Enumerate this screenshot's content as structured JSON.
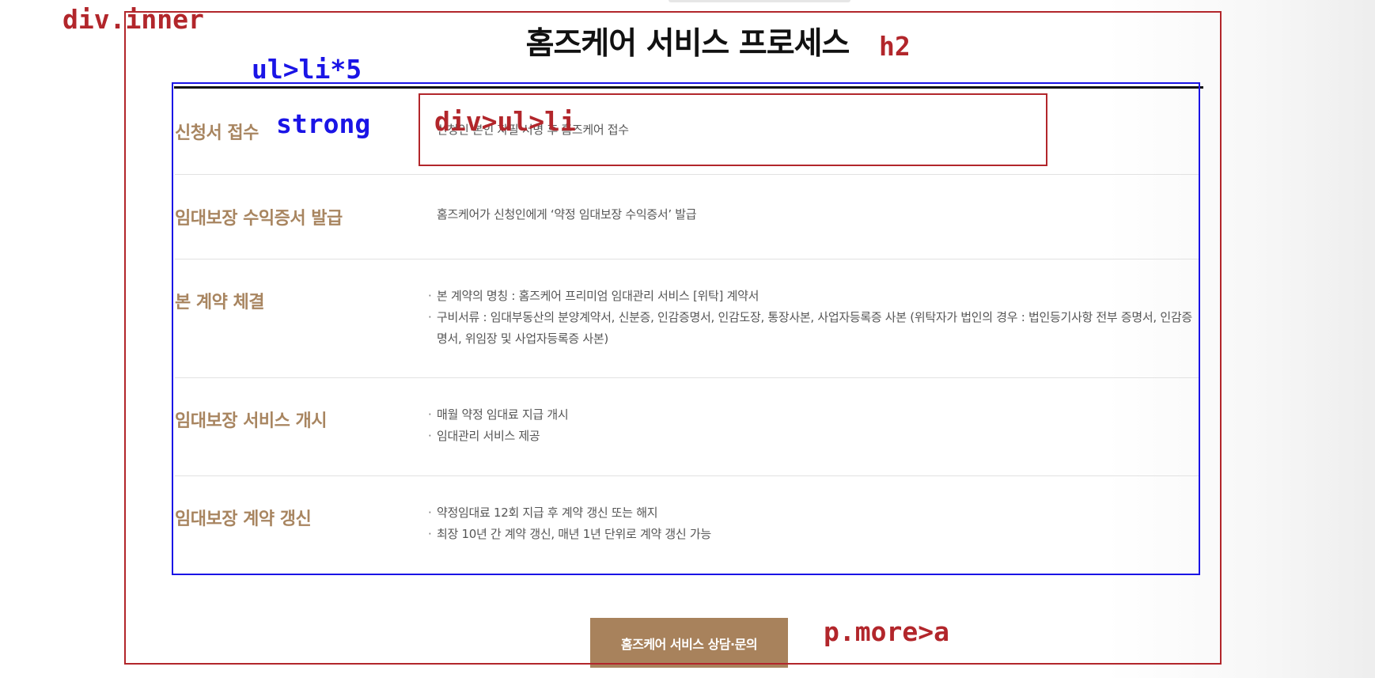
{
  "section": {
    "title": "홈즈케어 서비스 프로세스",
    "more_link": "홈즈케어 서비스 상담·문의"
  },
  "steps": [
    {
      "title": "신청서 접수",
      "items": [
        "신청인 본인 자필 서명 후 홈즈케어 접수"
      ],
      "bulleted": false
    },
    {
      "title": "임대보장 수익증서 발급",
      "items": [
        "홈즈케어가 신청인에게 ‘약정 임대보장 수익증서’ 발급"
      ],
      "bulleted": false
    },
    {
      "title": "본 계약 체결",
      "items": [
        "본 계약의 명칭 : 홈즈케어 프리미엄 임대관리 서비스 [위탁] 계약서",
        "구비서류 : 임대부동산의 분양계약서, 신분증, 인감증명서, 인감도장, 통장사본, 사업자등록증 사본 (위탁자가 법인의 경우 : 법인등기사항 전부 증명서, 인감증명서, 위임장 및 사업자등록증 사본)"
      ],
      "bulleted": true
    },
    {
      "title": "임대보장 서비스 개시",
      "items": [
        "매월 약정 임대료 지급 개시",
        "임대관리 서비스 제공"
      ],
      "bulleted": true
    },
    {
      "title": "임대보장 계약 갱신",
      "items": [
        "약정임대료 12회 지급 후 계약 갱신 또는 해지",
        "최장 10년 간 계약 갱신, 매년 1년 단위로 계약 갱신 가능"
      ],
      "bulleted": true
    }
  ],
  "annotations": {
    "div_inner": "div.inner",
    "h2": "h2",
    "ul_li": "ul>li*5",
    "strong": "strong",
    "div_ul_li": "div>ul>li",
    "p_more_a": "p.more>a"
  },
  "colors": {
    "annotation_red": "#b2262b",
    "annotation_blue": "#1a14e6",
    "step_title": "#a88560",
    "button_bg": "#a8825c",
    "text": "#555555",
    "heading": "#111111"
  }
}
